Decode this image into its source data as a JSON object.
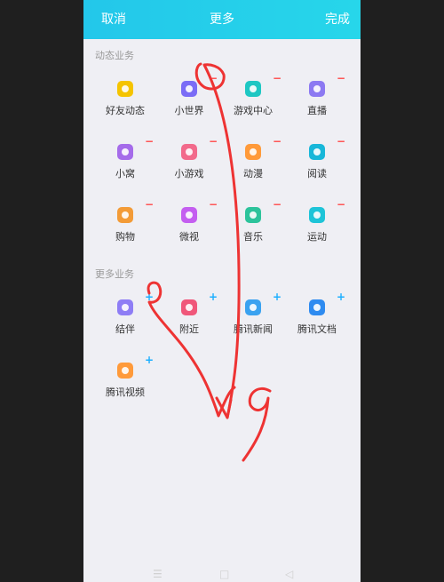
{
  "header": {
    "cancel": "取消",
    "title": "更多",
    "done": "完成"
  },
  "sections": [
    {
      "title": "动态业务",
      "badge": "−",
      "items": [
        {
          "label": "好友动态",
          "icon": "star-icon",
          "color": "#f5c400"
        },
        {
          "label": "小世界",
          "icon": "planet-icon",
          "color": "#7a6cf6"
        },
        {
          "label": "游戏中心",
          "icon": "gamepad-icon",
          "color": "#1ec7c3"
        },
        {
          "label": "直播",
          "icon": "live-icon",
          "color": "#8c79f2"
        },
        {
          "label": "小窝",
          "icon": "home-icon",
          "color": "#a56bea"
        },
        {
          "label": "小游戏",
          "icon": "game-character-icon",
          "color": "#f26a8b"
        },
        {
          "label": "动漫",
          "icon": "anime-icon",
          "color": "#ff9a3a"
        },
        {
          "label": "阅读",
          "icon": "book-icon",
          "color": "#18b7d9"
        },
        {
          "label": "购物",
          "icon": "shopping-icon",
          "color": "#f39b37"
        },
        {
          "label": "微视",
          "icon": "video-icon",
          "color": "#c45ef0"
        },
        {
          "label": "音乐",
          "icon": "music-icon",
          "color": "#2cc39b"
        },
        {
          "label": "运动",
          "icon": "sport-icon",
          "color": "#1ec4d8"
        }
      ]
    },
    {
      "title": "更多业务",
      "badge": "+",
      "items": [
        {
          "label": "结伴",
          "icon": "companion-icon",
          "color": "#8e7df5"
        },
        {
          "label": "附近",
          "icon": "location-icon",
          "color": "#f0577a"
        },
        {
          "label": "腾讯新闻",
          "icon": "news-icon",
          "color": "#3aa2f0"
        },
        {
          "label": "腾讯文档",
          "icon": "document-icon",
          "color": "#2e8bf0"
        },
        {
          "label": "腾讯视频",
          "icon": "play-icon",
          "color": "#ff9a3a"
        }
      ]
    }
  ],
  "navbar": {
    "menu": "☰",
    "home": "□",
    "back": "◁"
  }
}
